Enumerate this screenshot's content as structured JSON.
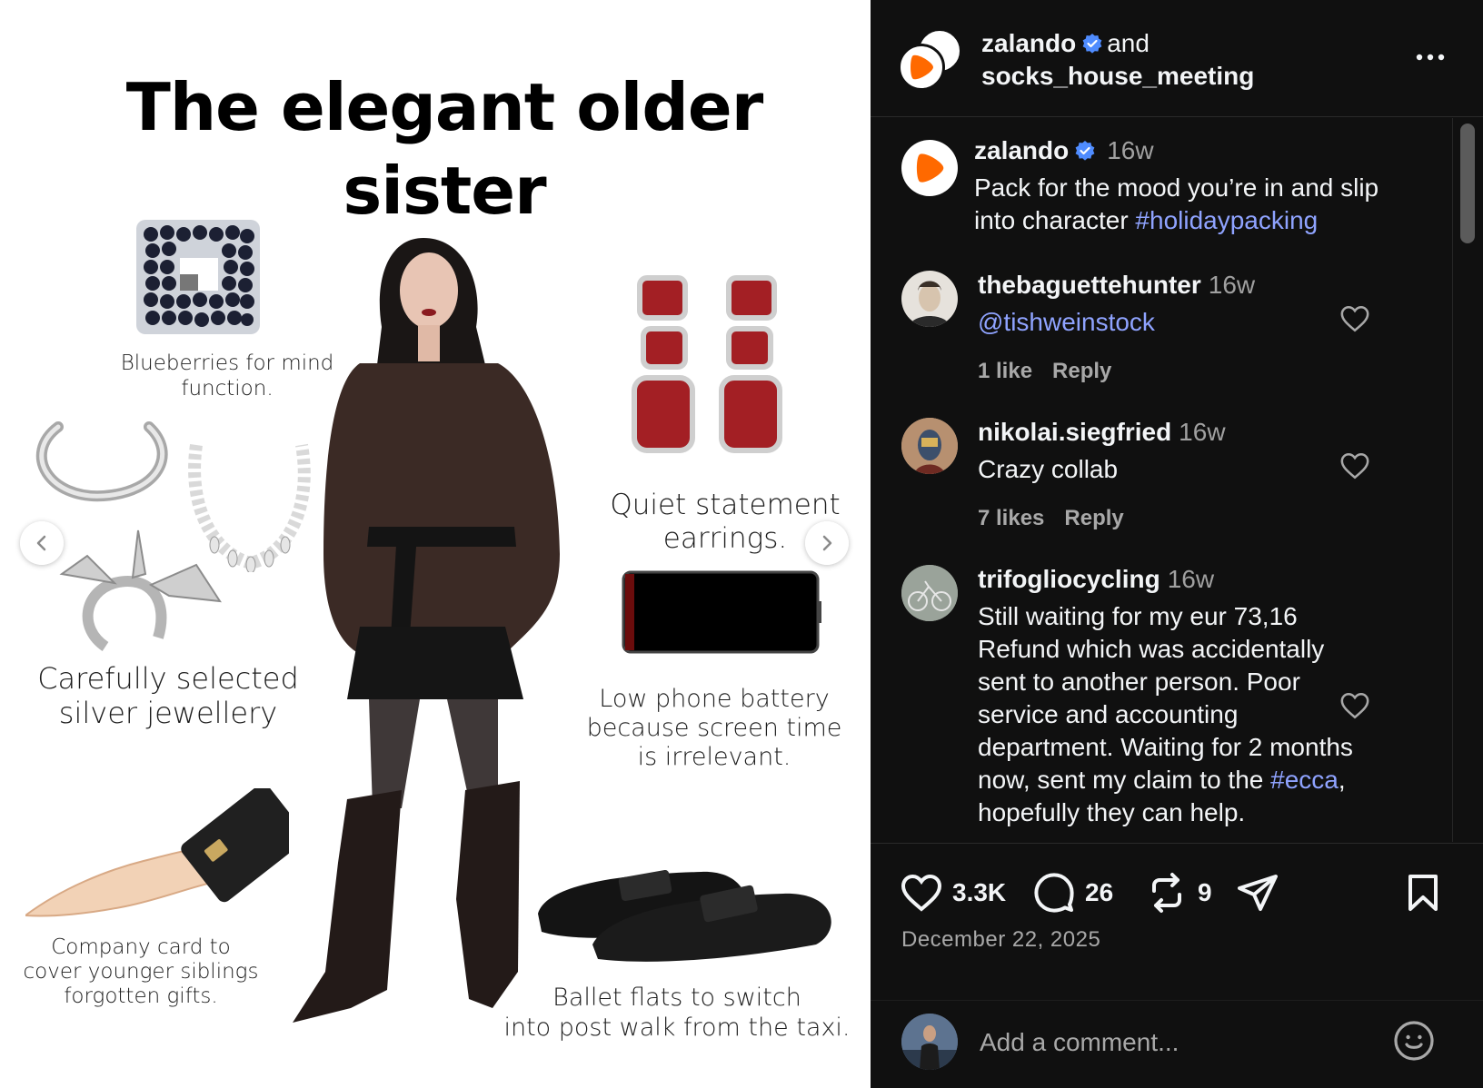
{
  "media": {
    "title_line1": "The elegant older",
    "title_line2": "sister",
    "captions": {
      "blueberries_1": "Blueberries for mind",
      "blueberries_2": "function.",
      "jewellery_1": "Carefully selected",
      "jewellery_2": "silver jewellery",
      "card_1": "Company card to",
      "card_2": "cover younger siblings",
      "card_3": "forgotten gifts.",
      "earrings_1": "Quiet statement",
      "earrings_2": "earrings.",
      "battery_1": "Low phone battery",
      "battery_2": "because screen time",
      "battery_3": "is irrelevant.",
      "flats_1": "Ballet flats to switch",
      "flats_2": "into post walk from the taxi."
    },
    "prev_icon": "chevron-left-icon",
    "next_icon": "chevron-right-icon"
  },
  "header": {
    "author": "zalando",
    "and": "and",
    "collaborator": "socks_house_meeting",
    "more_icon": "more-horizontal-icon"
  },
  "caption_post": {
    "username": "zalando",
    "time": "16w",
    "text_line1": "Pack for the mood you’re in and slip",
    "text_line2": "into character",
    "hashtag": "#holidaypacking"
  },
  "comments": [
    {
      "username": "thebaguettehunter",
      "time": "16w",
      "mention": "@tishweinstock",
      "likes": "1 like",
      "reply": "Reply"
    },
    {
      "username": "nikolai.siegfried",
      "time": "16w",
      "text": "Crazy collab",
      "likes": "7 likes",
      "reply": "Reply"
    },
    {
      "username": "trifogliocycling",
      "time": "16w",
      "lines": [
        "Still waiting for my eur 73,16",
        "Refund which was accidentally",
        "sent to another person. Poor",
        "service and accounting",
        "department. Waiting for 2 months",
        "now, sent my claim to the"
      ],
      "hashtag": "#ecca",
      "after_hashtag": ",",
      "last_line": "hopefully they can help."
    }
  ],
  "actions": {
    "likes": "3.3K",
    "comments": "26",
    "reposts": "9",
    "date": "December 22, 2025"
  },
  "comment_box": {
    "placeholder": "Add a comment..."
  },
  "colors": {
    "panel_bg": "#101010",
    "text": "#f3f5f7",
    "muted": "#a8a8a8",
    "link": "#8fa3ff",
    "verified": "#4f8cff",
    "brand": "#ff6900"
  }
}
